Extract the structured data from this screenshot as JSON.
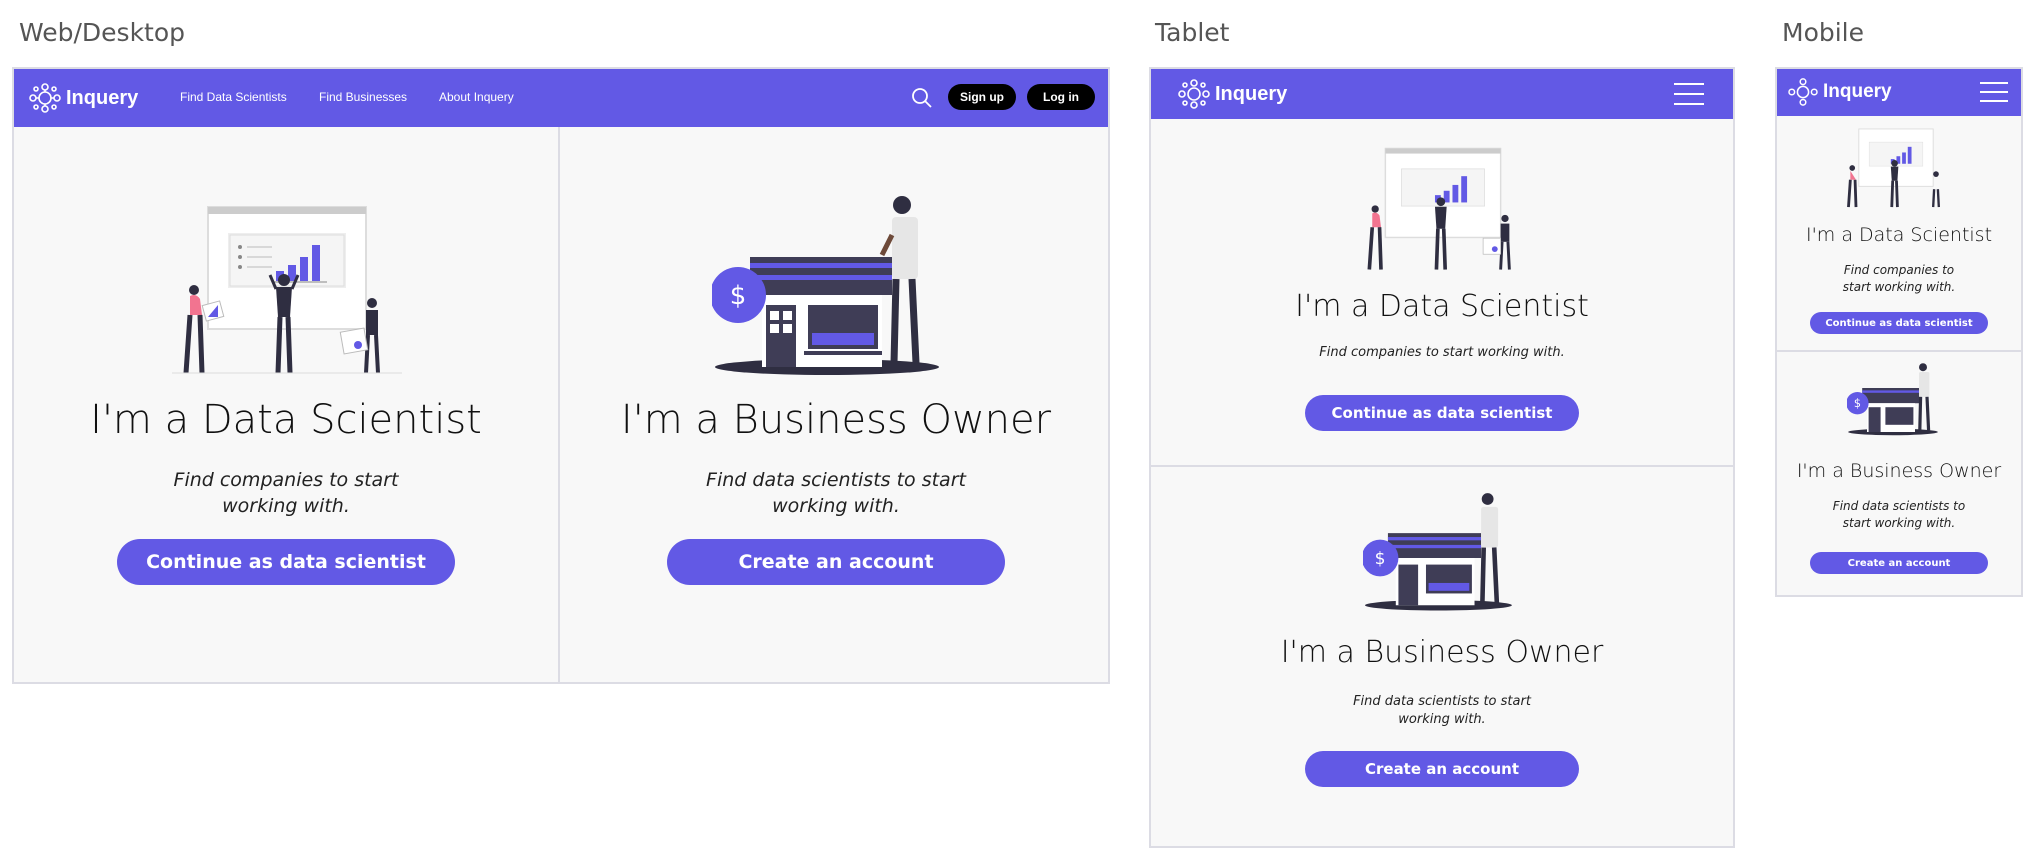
{
  "labels": {
    "desktop": "Web/Desktop",
    "tablet": "Tablet",
    "mobile": "Mobile"
  },
  "brand": {
    "name": "Inquery",
    "accent": "#6259e5"
  },
  "nav": {
    "links": [
      "Find Data Scientists",
      "Find Businesses",
      "About Inquery"
    ],
    "signup": "Sign up",
    "login": "Log in"
  },
  "scientist": {
    "title": "I'm a Data Scientist",
    "subtitle": "Find companies to start working with.",
    "cta": "Continue as data scientist"
  },
  "business": {
    "title": "I'm a Business Owner",
    "subtitle": "Find data scientists to start working with.",
    "cta": "Create an account"
  },
  "icons": {
    "logo": "network-logo-icon",
    "search": "search-icon",
    "menu": "hamburger-menu-icon",
    "dollar": "dollar-icon"
  }
}
